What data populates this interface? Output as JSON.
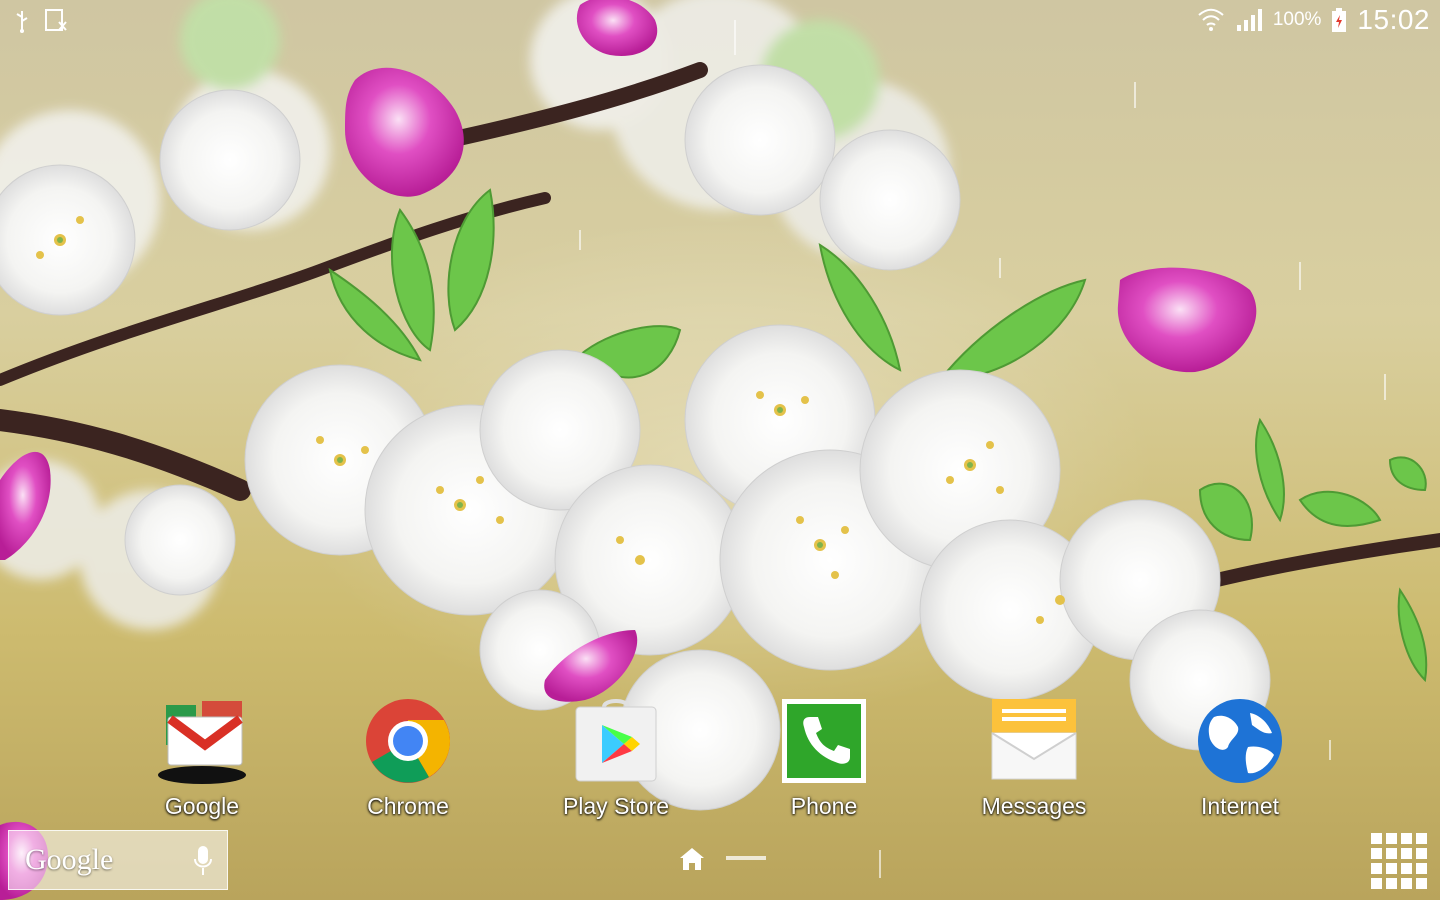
{
  "status": {
    "battery": "100%",
    "time": "15:02",
    "icons": [
      "usb-icon",
      "media-icon",
      "wifi-icon",
      "signal-icon",
      "battery-icon"
    ]
  },
  "apps": [
    {
      "label": "Google"
    },
    {
      "label": "Chrome"
    },
    {
      "label": "Play Store"
    },
    {
      "label": "Phone"
    },
    {
      "label": "Messages"
    },
    {
      "label": "Internet"
    }
  ],
  "search": {
    "logo": "Google"
  },
  "colors": {
    "petal": "#d93bb8",
    "leaf": "#6cc64a",
    "phone_green": "#2fa62a",
    "globe_blue": "#1e73d6"
  }
}
